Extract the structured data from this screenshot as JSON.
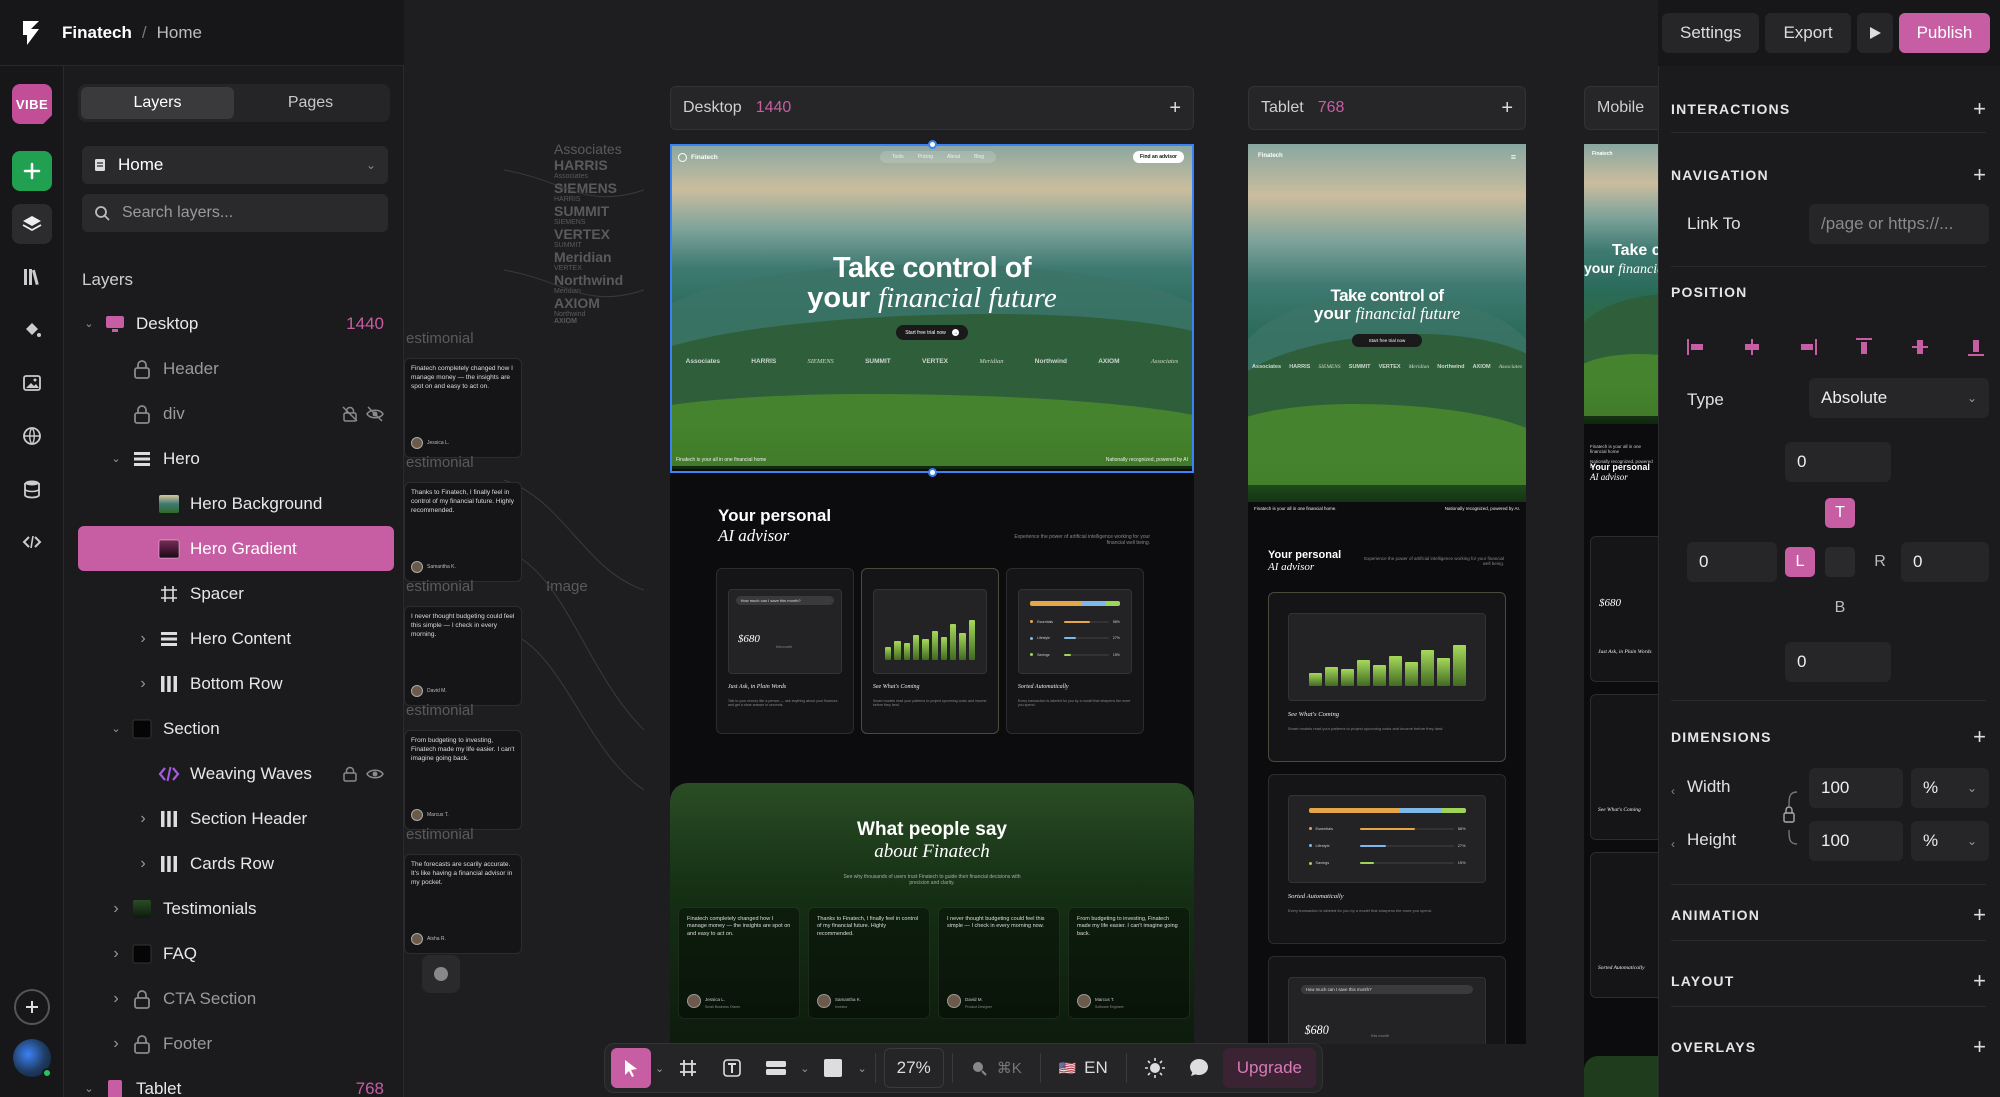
{
  "app": {
    "project": "Finatech",
    "separator": "/",
    "page": "Home",
    "vibe": "VIBE"
  },
  "left": {
    "tabs": [
      "Layers",
      "Pages"
    ],
    "page_select": "Home",
    "search_placeholder": "Search layers...",
    "layers_title": "Layers",
    "tree": [
      {
        "label": "Desktop",
        "depth": 0,
        "caret": "down",
        "icon": "desktop-frame-icon",
        "num": "1440"
      },
      {
        "label": "Header",
        "depth": 1,
        "icon": "lock-icon",
        "dim": true
      },
      {
        "label": "div",
        "depth": 1,
        "icon": "lock-icon",
        "dim": true,
        "trail": true
      },
      {
        "label": "Hero",
        "depth": 1,
        "caret": "down",
        "icon": "stack-icon"
      },
      {
        "label": "Hero Background",
        "depth": 2,
        "icon": "image-thumb-icon"
      },
      {
        "label": "Hero Gradient",
        "depth": 2,
        "icon": "gradient-icon",
        "selected": true
      },
      {
        "label": "Spacer",
        "depth": 2,
        "icon": "frame-icon"
      },
      {
        "label": "Hero Content",
        "depth": 2,
        "caret": "right",
        "icon": "stack-icon"
      },
      {
        "label": "Bottom Row",
        "depth": 2,
        "caret": "right",
        "icon": "columns-icon"
      },
      {
        "label": "Section",
        "depth": 1,
        "caret": "down",
        "icon": "black-square-icon"
      },
      {
        "label": "Weaving Waves",
        "depth": 2,
        "icon": "code-icon",
        "trail2": true
      },
      {
        "label": "Section Header",
        "depth": 2,
        "caret": "right",
        "icon": "columns-icon"
      },
      {
        "label": "Cards Row",
        "depth": 2,
        "caret": "right",
        "icon": "columns-icon"
      },
      {
        "label": "Testimonials",
        "depth": 1,
        "caret": "right",
        "icon": "green-square-icon"
      },
      {
        "label": "FAQ",
        "depth": 1,
        "caret": "right",
        "icon": "black-square-icon"
      },
      {
        "label": "CTA Section",
        "depth": 1,
        "caret": "right",
        "icon": "lock-icon",
        "dim": true
      },
      {
        "label": "Footer",
        "depth": 1,
        "caret": "right",
        "icon": "lock-icon",
        "dim": true
      },
      {
        "label": "Tablet",
        "depth": 0,
        "caret": "down",
        "icon": "tablet-frame-icon",
        "num": "768"
      }
    ]
  },
  "canvas": {
    "desktop": {
      "name": "Desktop",
      "width": "1440"
    },
    "tablet": {
      "name": "Tablet",
      "width": "768"
    },
    "mobile": {
      "name": "Mobile"
    },
    "ghost_logos": [
      "Associates",
      "HARRIS",
      "Associates",
      "SIEMENS",
      "HARRIS",
      "SUMMIT",
      "SIEMENS",
      "VERTEX",
      "SUMMIT",
      "Meridian",
      "VERTEX",
      "Northwind",
      "Meridian",
      "AXIOM",
      "Northwind",
      "AXIOM"
    ],
    "ghost_image": "Image",
    "ghost_testimonial": "estimonial",
    "site": {
      "brand": "Finatech",
      "nav": [
        "Tools",
        "Pricing",
        "About",
        "Blog"
      ],
      "nav_cta": "Find an advisor",
      "hero_line1": "Take control of",
      "hero_line2a": "your",
      "hero_line2b": "financial future",
      "hero_cta": "Start free trial now",
      "logos": [
        "Associates",
        "HARRIS",
        "SIEMENS",
        "SUMMIT",
        "VERTEX",
        "Meridian",
        "Northwind",
        "AXIOM",
        "Associates"
      ],
      "foot_left": "Finatech is your all in one financial home",
      "foot_right": "Nationally recognized, powered by AI",
      "tablet_foot_left": "Finatech is your all in one financial home.",
      "tablet_foot_right": "Nationally recognized, powered by AI.",
      "s2_title": "Your personal",
      "s2_title_it": "AI advisor",
      "s2_desc": "Experience the power of artificial intelligence working for your financial well being.",
      "cards": [
        {
          "title": "Just Ask, in Plain Words",
          "desc": "Talk to your money like a person — ask anything about your finances and get a clear answer in seconds.",
          "q": "How much can I save this month?",
          "amount": "$680",
          "amount_sub": "this month"
        },
        {
          "title": "See What's Coming",
          "desc": "Smart models read your patterns to project upcoming costs and income before they land.",
          "bars": [
            0.3,
            0.45,
            0.4,
            0.6,
            0.5,
            0.7,
            0.55,
            0.85,
            0.65,
            0.95
          ]
        },
        {
          "title": "Sorted Automatically",
          "desc": "Every transaction is labeled for you by a model that sharpens the more you spend.",
          "rows": [
            {
              "n": "Essentials",
              "v": 0.58,
              "p": "58%",
              "c": "#e5a64a"
            },
            {
              "n": "Lifestyle",
              "v": 0.27,
              "p": "27%",
              "c": "#7fb8e8"
            },
            {
              "n": "Savings",
              "v": 0.15,
              "p": "15%",
              "c": "#9fd45a"
            }
          ]
        }
      ],
      "t_title": "What people say",
      "t_title_it": "about Finatech",
      "t_desc": "See why thousands of users trust Finatech to guide their financial decisions with precision and clarity.",
      "testimonials": [
        {
          "q": "Finatech completely changed how I manage money — the insights are spot on and easy to act on.",
          "n": "Jessica L.",
          "r": "Small Business Owner"
        },
        {
          "q": "Thanks to Finatech, I finally feel in control of my financial future. Highly recommended.",
          "n": "Samantha K.",
          "r": "Investor"
        },
        {
          "q": "I never thought budgeting could feel this simple — I check in every morning now.",
          "n": "David M.",
          "r": "Product Designer"
        },
        {
          "q": "From budgeting to investing, Finatech made my life easier. I can't imagine going back.",
          "n": "Marcus T.",
          "r": "Software Engineer"
        }
      ],
      "strip_quotes": [
        {
          "q": "Finatech completely changed how I manage money — the insights are spot on and easy to act on.",
          "n": "Jessica L."
        },
        {
          "q": "Thanks to Finatech, I finally feel in control of my financial future. Highly recommended.",
          "n": "Samantha K."
        },
        {
          "q": "I never thought budgeting could feel this simple — I check in every morning.",
          "n": "David M."
        },
        {
          "q": "From budgeting to investing, Finatech made my life easier. I can't imagine going back.",
          "n": "Marcus T."
        },
        {
          "q": "The forecasts are scarily accurate. It's like having a financial advisor in my pocket.",
          "n": "Aisha R."
        }
      ]
    }
  },
  "toolbar": {
    "zoom": "27%",
    "shortcut": "⌘K",
    "lang": "EN",
    "flag": "🇺🇸",
    "upgrade": "Upgrade"
  },
  "right": {
    "settings": "Settings",
    "export": "Export",
    "publish": "Publish",
    "sections": {
      "interactions": "INTERACTIONS",
      "navigation": "NAVIGATION",
      "position": "POSITION",
      "dimensions": "DIMENSIONS",
      "animation": "ANIMATION",
      "layout": "LAYOUT",
      "overlays": "OVERLAYS"
    },
    "link_to_label": "Link To",
    "link_placeholder": "/page or https://...",
    "type_label": "Type",
    "type_value": "Absolute",
    "pos": {
      "top": "0",
      "left": "0",
      "right": "0",
      "bottom": "0",
      "T": "T",
      "L": "L",
      "R": "R",
      "B": "B"
    },
    "width_label": "Width",
    "width_value": "100",
    "width_unit": "%",
    "height_label": "Height",
    "height_value": "100",
    "height_unit": "%"
  },
  "colors": {
    "accent": "#c75ea4",
    "green": "#22a052",
    "select_blue": "#3b82f6"
  }
}
